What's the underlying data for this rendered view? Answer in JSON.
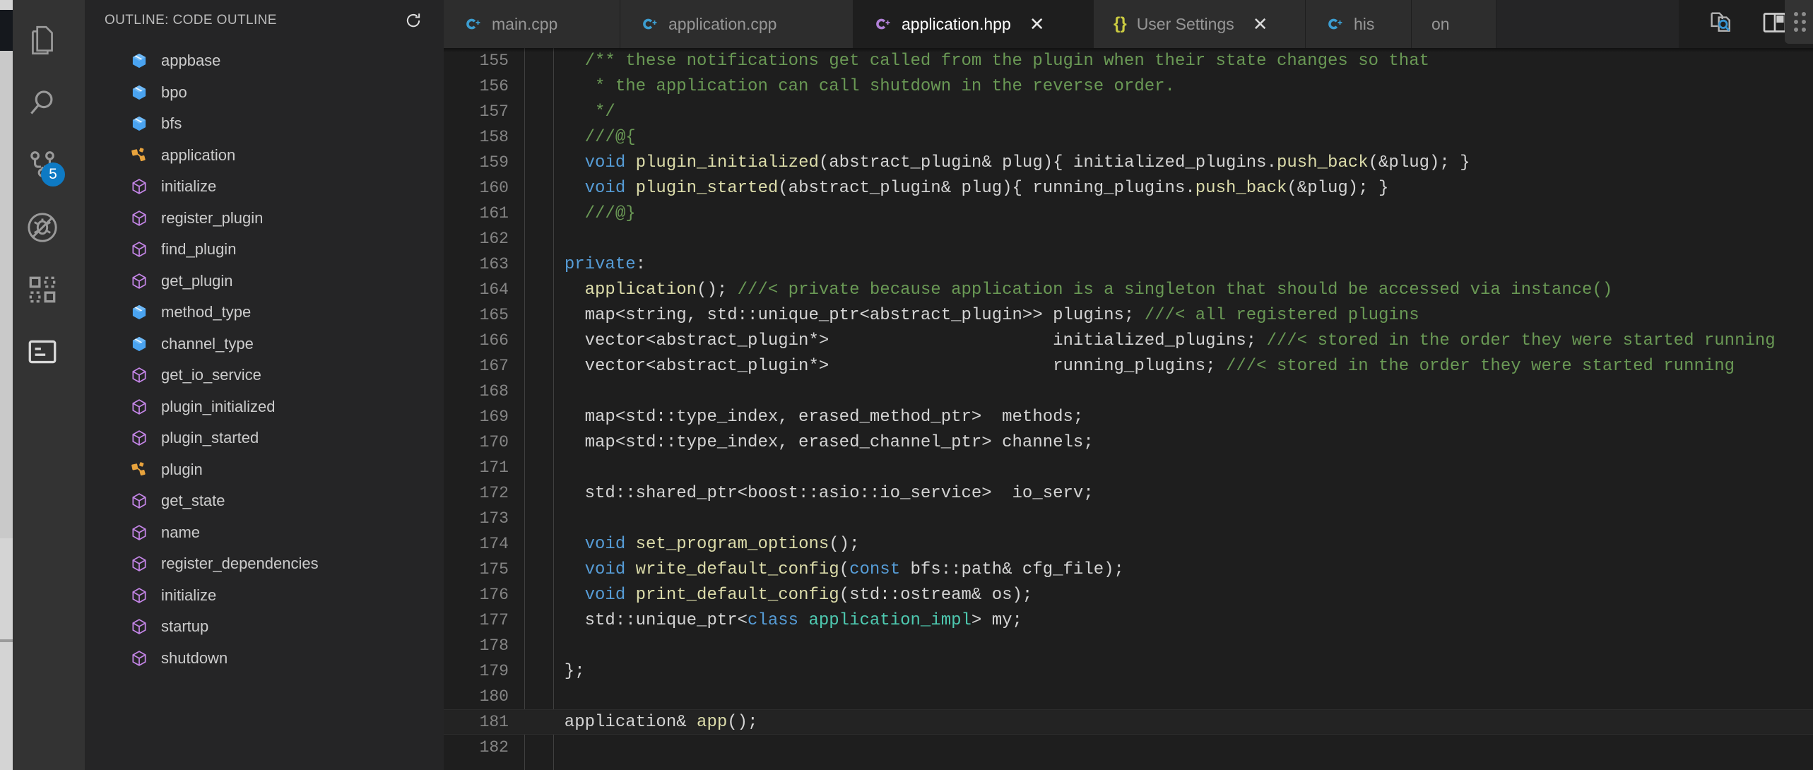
{
  "window": {
    "accent_blue": "#0e7ac4",
    "editor_bg": "#1e1e1e",
    "sidebar_bg": "#252526",
    "activitybar_bg": "#333333"
  },
  "activity_bar": {
    "items": [
      {
        "name": "explorer",
        "icon": "files-icon",
        "badge": null
      },
      {
        "name": "search",
        "icon": "search-icon",
        "badge": null
      },
      {
        "name": "source-control",
        "icon": "source-control-icon",
        "badge": "5"
      },
      {
        "name": "run-and-debug",
        "icon": "debug-disabled-icon",
        "badge": null
      },
      {
        "name": "extensions",
        "icon": "extensions-icon",
        "badge": null
      },
      {
        "name": "outline-view",
        "icon": "outline-icon",
        "badge": null
      }
    ]
  },
  "sidebar": {
    "title": "OUTLINE: CODE OUTLINE",
    "refresh_icon": "refresh-icon",
    "items": [
      {
        "label": "appbase",
        "kind": "namespace",
        "icon": "namespace-cube-icon"
      },
      {
        "label": "bpo",
        "kind": "namespace",
        "icon": "namespace-cube-icon"
      },
      {
        "label": "bfs",
        "kind": "namespace",
        "icon": "namespace-cube-icon"
      },
      {
        "label": "application",
        "kind": "class",
        "icon": "class-icon"
      },
      {
        "label": "initialize",
        "kind": "method",
        "icon": "method-cube-icon"
      },
      {
        "label": "register_plugin",
        "kind": "method",
        "icon": "method-cube-icon"
      },
      {
        "label": "find_plugin",
        "kind": "method",
        "icon": "method-cube-icon"
      },
      {
        "label": "get_plugin",
        "kind": "method",
        "icon": "method-cube-icon"
      },
      {
        "label": "method_type",
        "kind": "namespace",
        "icon": "namespace-cube-icon"
      },
      {
        "label": "channel_type",
        "kind": "namespace",
        "icon": "namespace-cube-icon"
      },
      {
        "label": "get_io_service",
        "kind": "method",
        "icon": "method-cube-icon"
      },
      {
        "label": "plugin_initialized",
        "kind": "method",
        "icon": "method-cube-icon"
      },
      {
        "label": "plugin_started",
        "kind": "method",
        "icon": "method-cube-icon"
      },
      {
        "label": "plugin",
        "kind": "class",
        "icon": "class-icon"
      },
      {
        "label": "get_state",
        "kind": "method",
        "icon": "method-cube-icon"
      },
      {
        "label": "name",
        "kind": "method",
        "icon": "method-cube-icon"
      },
      {
        "label": "register_dependencies",
        "kind": "method",
        "icon": "method-cube-icon"
      },
      {
        "label": "initialize",
        "kind": "method",
        "icon": "method-cube-icon"
      },
      {
        "label": "startup",
        "kind": "method",
        "icon": "method-cube-icon"
      },
      {
        "label": "shutdown",
        "kind": "method",
        "icon": "method-cube-icon"
      }
    ]
  },
  "tabs": [
    {
      "label": "main.cpp",
      "icon": "cpp-file-icon",
      "active": false,
      "dirty": false,
      "closable": false
    },
    {
      "label": "application.cpp",
      "icon": "cpp-file-icon",
      "active": false,
      "dirty": false,
      "closable": false
    },
    {
      "label": "application.hpp",
      "icon": "hpp-file-icon",
      "active": true,
      "dirty": false,
      "closable": true,
      "close_label": "✕"
    },
    {
      "label": "User Settings",
      "icon": "json-file-icon",
      "active": false,
      "dirty": false,
      "closable": true,
      "close_label": "✕"
    },
    {
      "label": "his",
      "icon": "cpp-file-icon",
      "active": false,
      "dirty": false,
      "closable": false
    },
    {
      "label": "on",
      "icon": "none",
      "active": false,
      "dirty": false,
      "closable": false
    }
  ],
  "debug_toolbar": {
    "grip": "drag-handle-icon",
    "buttons": [
      {
        "name": "continue-button",
        "icon": "play-icon",
        "color": "#89d185"
      },
      {
        "name": "step-over-button",
        "icon": "step-over-icon",
        "color": "#75beff"
      },
      {
        "name": "step-into-button",
        "icon": "step-into-icon",
        "color": "#75beff"
      },
      {
        "name": "step-out-button",
        "icon": "step-out-icon",
        "color": "#75beff"
      },
      {
        "name": "restart-button",
        "icon": "restart-icon",
        "color": "#89d185"
      },
      {
        "name": "stop-button",
        "icon": "stop-icon",
        "color": "#f48771"
      }
    ]
  },
  "editor_actions": [
    {
      "name": "open-changes-button",
      "icon": "file-search-icon"
    },
    {
      "name": "split-editor-button",
      "icon": "split-editor-icon"
    }
  ],
  "code": {
    "language": "cpp",
    "first_line": 155,
    "lines": [
      {
        "n": 155,
        "segments": [
          {
            "t": "    /** these notifications get called from the plugin when their state changes so that",
            "c": "com"
          }
        ]
      },
      {
        "n": 156,
        "segments": [
          {
            "t": "     * the application can call shutdown in the reverse order.",
            "c": "com"
          }
        ]
      },
      {
        "n": 157,
        "segments": [
          {
            "t": "     */",
            "c": "com"
          }
        ]
      },
      {
        "n": 158,
        "segments": [
          {
            "t": "    ///@{",
            "c": "com"
          }
        ]
      },
      {
        "n": 159,
        "segments": [
          {
            "t": "    ",
            "c": "txt"
          },
          {
            "t": "void",
            "c": "kw"
          },
          {
            "t": " ",
            "c": "txt"
          },
          {
            "t": "plugin_initialized",
            "c": "fn"
          },
          {
            "t": "(abstract_plugin& plug){ initialized_plugins.",
            "c": "txt"
          },
          {
            "t": "push_back",
            "c": "fn"
          },
          {
            "t": "(&plug); }",
            "c": "txt"
          }
        ]
      },
      {
        "n": 160,
        "segments": [
          {
            "t": "    ",
            "c": "txt"
          },
          {
            "t": "void",
            "c": "kw"
          },
          {
            "t": " ",
            "c": "txt"
          },
          {
            "t": "plugin_started",
            "c": "fn"
          },
          {
            "t": "(abstract_plugin& plug){ running_plugins.",
            "c": "txt"
          },
          {
            "t": "push_back",
            "c": "fn"
          },
          {
            "t": "(&plug); }",
            "c": "txt"
          }
        ]
      },
      {
        "n": 161,
        "segments": [
          {
            "t": "    ///@}",
            "c": "com"
          }
        ]
      },
      {
        "n": 162,
        "segments": [
          {
            "t": "",
            "c": "txt"
          }
        ]
      },
      {
        "n": 163,
        "segments": [
          {
            "t": "  ",
            "c": "txt"
          },
          {
            "t": "private",
            "c": "kw"
          },
          {
            "t": ":",
            "c": "txt"
          }
        ]
      },
      {
        "n": 164,
        "segments": [
          {
            "t": "    ",
            "c": "txt"
          },
          {
            "t": "application",
            "c": "fn"
          },
          {
            "t": "(); ",
            "c": "txt"
          },
          {
            "t": "///< private because application is a singleton that should be accessed via instance()",
            "c": "com"
          }
        ]
      },
      {
        "n": 165,
        "segments": [
          {
            "t": "    map<string, std::unique_ptr<abstract_plugin>> plugins; ",
            "c": "txt"
          },
          {
            "t": "///< all registered plugins",
            "c": "com"
          }
        ]
      },
      {
        "n": 166,
        "segments": [
          {
            "t": "    vector<abstract_plugin*>                      initialized_plugins; ",
            "c": "txt"
          },
          {
            "t": "///< stored in the order they were started running",
            "c": "com"
          }
        ]
      },
      {
        "n": 167,
        "segments": [
          {
            "t": "    vector<abstract_plugin*>                      running_plugins; ",
            "c": "txt"
          },
          {
            "t": "///< stored in the order they were started running",
            "c": "com"
          }
        ]
      },
      {
        "n": 168,
        "segments": [
          {
            "t": "",
            "c": "txt"
          }
        ]
      },
      {
        "n": 169,
        "segments": [
          {
            "t": "    map<std::type_index, erased_method_ptr>  methods;",
            "c": "txt"
          }
        ]
      },
      {
        "n": 170,
        "segments": [
          {
            "t": "    map<std::type_index, erased_channel_ptr> channels;",
            "c": "txt"
          }
        ]
      },
      {
        "n": 171,
        "segments": [
          {
            "t": "",
            "c": "txt"
          }
        ]
      },
      {
        "n": 172,
        "segments": [
          {
            "t": "    std::shared_ptr<boost::asio::io_service>  io_serv;",
            "c": "txt"
          }
        ]
      },
      {
        "n": 173,
        "segments": [
          {
            "t": "",
            "c": "txt"
          }
        ]
      },
      {
        "n": 174,
        "segments": [
          {
            "t": "    ",
            "c": "txt"
          },
          {
            "t": "void",
            "c": "kw"
          },
          {
            "t": " ",
            "c": "txt"
          },
          {
            "t": "set_program_options",
            "c": "fn"
          },
          {
            "t": "();",
            "c": "txt"
          }
        ]
      },
      {
        "n": 175,
        "segments": [
          {
            "t": "    ",
            "c": "txt"
          },
          {
            "t": "void",
            "c": "kw"
          },
          {
            "t": " ",
            "c": "txt"
          },
          {
            "t": "write_default_config",
            "c": "fn"
          },
          {
            "t": "(",
            "c": "txt"
          },
          {
            "t": "const",
            "c": "kw"
          },
          {
            "t": " bfs::path& cfg_file);",
            "c": "txt"
          }
        ]
      },
      {
        "n": 176,
        "segments": [
          {
            "t": "    ",
            "c": "txt"
          },
          {
            "t": "void",
            "c": "kw"
          },
          {
            "t": " ",
            "c": "txt"
          },
          {
            "t": "print_default_config",
            "c": "fn"
          },
          {
            "t": "(std::ostream& os);",
            "c": "txt"
          }
        ]
      },
      {
        "n": 177,
        "segments": [
          {
            "t": "    std::unique_ptr<",
            "c": "txt"
          },
          {
            "t": "class",
            "c": "kw"
          },
          {
            "t": " ",
            "c": "txt"
          },
          {
            "t": "application_impl",
            "c": "typ"
          },
          {
            "t": "> my;",
            "c": "txt"
          }
        ]
      },
      {
        "n": 178,
        "segments": [
          {
            "t": "",
            "c": "txt"
          }
        ]
      },
      {
        "n": 179,
        "segments": [
          {
            "t": "  };",
            "c": "txt"
          }
        ]
      },
      {
        "n": 180,
        "segments": [
          {
            "t": "",
            "c": "txt"
          }
        ]
      },
      {
        "n": 181,
        "highlight": true,
        "segments": [
          {
            "t": "  application& ",
            "c": "txt"
          },
          {
            "t": "app",
            "c": "fn"
          },
          {
            "t": "();",
            "c": "txt"
          }
        ]
      },
      {
        "n": 182,
        "segments": [
          {
            "t": "",
            "c": "txt"
          }
        ]
      }
    ]
  }
}
